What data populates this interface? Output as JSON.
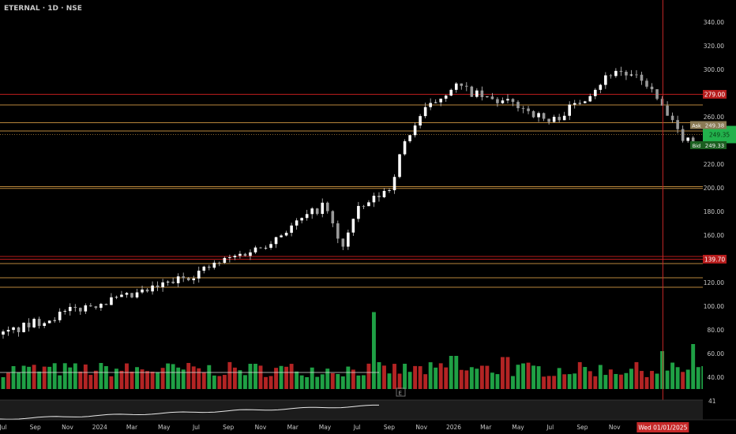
{
  "chart_data": {
    "type": "candlestick",
    "title": "ETERNAL · 1D · NSE",
    "symbol": "ETERNAL",
    "interval": "1D",
    "exchange": "NSE",
    "x_tick_labels": [
      "Jul",
      "Sep",
      "Nov",
      "2024",
      "Mar",
      "May",
      "Jul",
      "Sep",
      "Nov",
      "Mar",
      "May",
      "Jul",
      "Sep",
      "Nov",
      "2026",
      "Mar",
      "May",
      "Jul",
      "Sep",
      "Nov",
      "2027"
    ],
    "y_tick_labels": [
      "340.00",
      "320.00",
      "300.00",
      "280.00",
      "260.00",
      "240.00",
      "220.00",
      "200.00",
      "180.00",
      "160.00",
      "140.00",
      "120.00",
      "100.00",
      "80.00",
      "60.00",
      "40.00"
    ],
    "ylim": [
      30,
      348
    ],
    "crosshair_date_label": "Wed 01/01/2025",
    "crosshair_x_index": 20.5,
    "price_labels": [
      {
        "text": "279.00",
        "value": 279,
        "color": "#b71c1c"
      },
      {
        "text": "139.70",
        "value": 139.7,
        "color": "#b71c1c"
      }
    ],
    "ask_label": {
      "prefix": "Ask",
      "text": "249.38",
      "value": 253,
      "color": "#8a7a55"
    },
    "bid_label": {
      "prefix": "Bid",
      "text": "249.33",
      "value": 236,
      "color": "#1b5e20"
    },
    "current_price_box": {
      "text": "249.35",
      "value": 245,
      "color": "#22b14c"
    },
    "horizontal_levels": [
      {
        "value": 279,
        "color": "#b71c1c"
      },
      {
        "value": 270,
        "color": "#b8863b"
      },
      {
        "value": 255,
        "color": "#b8863b"
      },
      {
        "value": 248,
        "color": "#b8863b"
      },
      {
        "value": 201,
        "color": "#b8863b"
      },
      {
        "value": 199.5,
        "color": "#b8863b"
      },
      {
        "value": 142,
        "color": "#b71c1c"
      },
      {
        "value": 139.7,
        "color": "#b71c1c"
      },
      {
        "value": 136,
        "color": "#b8863b"
      },
      {
        "value": 124,
        "color": "#b8863b"
      },
      {
        "value": 116,
        "color": "#b8863b"
      }
    ],
    "trendline_start": {
      "x_index": 38.8,
      "value": 195
    },
    "trendline_end": {
      "x_index": 46.3,
      "value": 298
    },
    "target_arrow_start": {
      "x_index": 45.3,
      "value": 253
    },
    "target_arrow_end": {
      "x_index": 51.5,
      "value": 270
    },
    "entry_zone": {
      "x_start_index": 43.7,
      "x_end_index": 50.3,
      "top": 253,
      "bottom": 247,
      "color": "#22b14c"
    },
    "price_series": {
      "start_index": 0,
      "step": 0.16,
      "noise": 4,
      "anchors": [
        [
          0,
          76
        ],
        [
          1,
          86
        ],
        [
          2,
          95
        ],
        [
          3,
          103
        ],
        [
          4,
          108
        ],
        [
          5,
          118
        ],
        [
          6,
          128
        ],
        [
          7,
          140
        ],
        [
          8,
          150
        ],
        [
          9,
          168
        ],
        [
          10,
          186
        ],
        [
          10.5,
          148
        ],
        [
          11,
          180
        ],
        [
          12,
          200
        ],
        [
          12.5,
          240
        ],
        [
          13,
          262
        ],
        [
          14,
          287
        ],
        [
          15,
          275
        ],
        [
          16,
          270
        ],
        [
          17,
          255
        ],
        [
          18,
          275
        ],
        [
          19,
          300
        ],
        [
          20,
          288
        ],
        [
          21,
          245
        ],
        [
          22,
          230
        ],
        [
          23,
          210
        ],
        [
          24,
          225
        ],
        [
          25,
          215
        ],
        [
          26,
          205
        ],
        [
          27,
          230
        ],
        [
          28,
          245
        ],
        [
          28.5,
          257
        ],
        [
          29,
          249
        ]
      ]
    },
    "volume_series": {
      "baseline_value": 30,
      "max_value": 108,
      "noise": 8,
      "spikes": [
        [
          11.5,
          95
        ],
        [
          14,
          58
        ],
        [
          15.6,
          57
        ],
        [
          20.5,
          62
        ],
        [
          21.5,
          68
        ],
        [
          23,
          70
        ],
        [
          28,
          108
        ],
        [
          29,
          52
        ]
      ]
    },
    "volume_ma_level": 52,
    "indicator_label": "41",
    "colors": {
      "up": "#22b14c",
      "down": "#c62828",
      "wick": "#c8c8c8",
      "axis_text": "#c8c8c8",
      "crosshair": "#c62828",
      "trendline": "#d8c49a",
      "arrow": "#22b14c"
    }
  }
}
